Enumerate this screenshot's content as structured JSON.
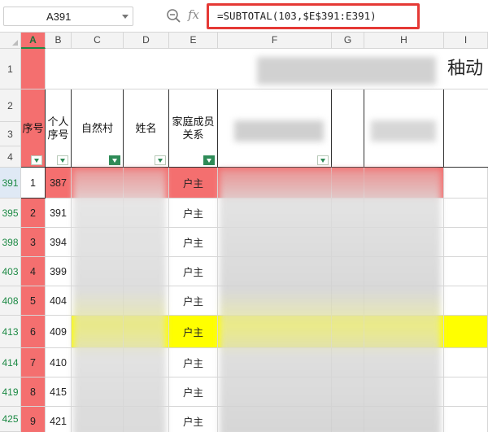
{
  "name_box": "A391",
  "formula": "=SUBTOTAL(103,$E$391:E391)",
  "fx_label": "fx",
  "columns": [
    "A",
    "B",
    "C",
    "D",
    "E",
    "F",
    "G",
    "H",
    "I"
  ],
  "row_numbers_top": [
    "1",
    "2",
    "3",
    "4"
  ],
  "headers": {
    "seq": "序号",
    "person_seq": "个人序号",
    "village": "自然村",
    "name": "姓名",
    "relation": "家庭成员关系"
  },
  "title_fragment": "秞动",
  "rows": [
    {
      "rownum": "391",
      "seq": "1",
      "pseq": "387",
      "rel": "户主"
    },
    {
      "rownum": "395",
      "seq": "2",
      "pseq": "391",
      "rel": "户主"
    },
    {
      "rownum": "398",
      "seq": "3",
      "pseq": "394",
      "rel": "户主"
    },
    {
      "rownum": "403",
      "seq": "4",
      "pseq": "399",
      "rel": "户主"
    },
    {
      "rownum": "408",
      "seq": "5",
      "pseq": "404",
      "rel": "户主"
    },
    {
      "rownum": "413",
      "seq": "6",
      "pseq": "409",
      "rel": "户主"
    },
    {
      "rownum": "414",
      "seq": "7",
      "pseq": "410",
      "rel": "户主"
    },
    {
      "rownum": "419",
      "seq": "8",
      "pseq": "415",
      "rel": "户主"
    },
    {
      "rownum": "425",
      "seq": "9",
      "pseq": "421",
      "rel": "户主"
    }
  ],
  "colors": {
    "highlight_red": "#f46f6f",
    "highlight_yellow": "#ffff00",
    "formula_border": "#e53935",
    "row_number_green": "#1d8a45"
  }
}
